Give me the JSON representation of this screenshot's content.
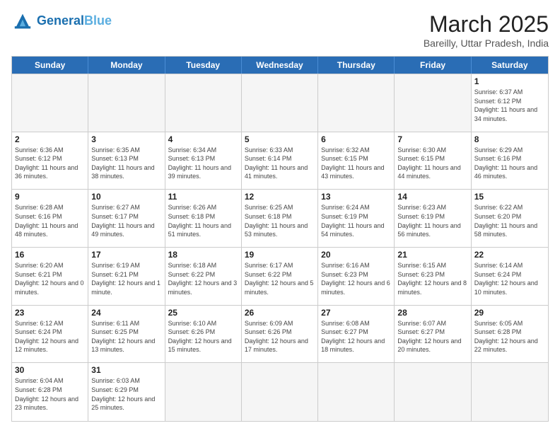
{
  "header": {
    "logo_general": "General",
    "logo_blue": "Blue",
    "month_title": "March 2025",
    "subtitle": "Bareilly, Uttar Pradesh, India"
  },
  "day_headers": [
    "Sunday",
    "Monday",
    "Tuesday",
    "Wednesday",
    "Thursday",
    "Friday",
    "Saturday"
  ],
  "days": [
    {
      "num": "",
      "sunrise": "",
      "sunset": "",
      "daylight": "",
      "empty": true
    },
    {
      "num": "",
      "sunrise": "",
      "sunset": "",
      "daylight": "",
      "empty": true
    },
    {
      "num": "",
      "sunrise": "",
      "sunset": "",
      "daylight": "",
      "empty": true
    },
    {
      "num": "",
      "sunrise": "",
      "sunset": "",
      "daylight": "",
      "empty": true
    },
    {
      "num": "",
      "sunrise": "",
      "sunset": "",
      "daylight": "",
      "empty": true
    },
    {
      "num": "",
      "sunrise": "",
      "sunset": "",
      "daylight": "",
      "empty": true
    },
    {
      "num": "1",
      "sunrise": "Sunrise: 6:37 AM",
      "sunset": "Sunset: 6:12 PM",
      "daylight": "Daylight: 11 hours and 34 minutes.",
      "empty": false
    },
    {
      "num": "2",
      "sunrise": "Sunrise: 6:36 AM",
      "sunset": "Sunset: 6:12 PM",
      "daylight": "Daylight: 11 hours and 36 minutes.",
      "empty": false
    },
    {
      "num": "3",
      "sunrise": "Sunrise: 6:35 AM",
      "sunset": "Sunset: 6:13 PM",
      "daylight": "Daylight: 11 hours and 38 minutes.",
      "empty": false
    },
    {
      "num": "4",
      "sunrise": "Sunrise: 6:34 AM",
      "sunset": "Sunset: 6:13 PM",
      "daylight": "Daylight: 11 hours and 39 minutes.",
      "empty": false
    },
    {
      "num": "5",
      "sunrise": "Sunrise: 6:33 AM",
      "sunset": "Sunset: 6:14 PM",
      "daylight": "Daylight: 11 hours and 41 minutes.",
      "empty": false
    },
    {
      "num": "6",
      "sunrise": "Sunrise: 6:32 AM",
      "sunset": "Sunset: 6:15 PM",
      "daylight": "Daylight: 11 hours and 43 minutes.",
      "empty": false
    },
    {
      "num": "7",
      "sunrise": "Sunrise: 6:30 AM",
      "sunset": "Sunset: 6:15 PM",
      "daylight": "Daylight: 11 hours and 44 minutes.",
      "empty": false
    },
    {
      "num": "8",
      "sunrise": "Sunrise: 6:29 AM",
      "sunset": "Sunset: 6:16 PM",
      "daylight": "Daylight: 11 hours and 46 minutes.",
      "empty": false
    },
    {
      "num": "9",
      "sunrise": "Sunrise: 6:28 AM",
      "sunset": "Sunset: 6:16 PM",
      "daylight": "Daylight: 11 hours and 48 minutes.",
      "empty": false
    },
    {
      "num": "10",
      "sunrise": "Sunrise: 6:27 AM",
      "sunset": "Sunset: 6:17 PM",
      "daylight": "Daylight: 11 hours and 49 minutes.",
      "empty": false
    },
    {
      "num": "11",
      "sunrise": "Sunrise: 6:26 AM",
      "sunset": "Sunset: 6:18 PM",
      "daylight": "Daylight: 11 hours and 51 minutes.",
      "empty": false
    },
    {
      "num": "12",
      "sunrise": "Sunrise: 6:25 AM",
      "sunset": "Sunset: 6:18 PM",
      "daylight": "Daylight: 11 hours and 53 minutes.",
      "empty": false
    },
    {
      "num": "13",
      "sunrise": "Sunrise: 6:24 AM",
      "sunset": "Sunset: 6:19 PM",
      "daylight": "Daylight: 11 hours and 54 minutes.",
      "empty": false
    },
    {
      "num": "14",
      "sunrise": "Sunrise: 6:23 AM",
      "sunset": "Sunset: 6:19 PM",
      "daylight": "Daylight: 11 hours and 56 minutes.",
      "empty": false
    },
    {
      "num": "15",
      "sunrise": "Sunrise: 6:22 AM",
      "sunset": "Sunset: 6:20 PM",
      "daylight": "Daylight: 11 hours and 58 minutes.",
      "empty": false
    },
    {
      "num": "16",
      "sunrise": "Sunrise: 6:20 AM",
      "sunset": "Sunset: 6:21 PM",
      "daylight": "Daylight: 12 hours and 0 minutes.",
      "empty": false
    },
    {
      "num": "17",
      "sunrise": "Sunrise: 6:19 AM",
      "sunset": "Sunset: 6:21 PM",
      "daylight": "Daylight: 12 hours and 1 minute.",
      "empty": false
    },
    {
      "num": "18",
      "sunrise": "Sunrise: 6:18 AM",
      "sunset": "Sunset: 6:22 PM",
      "daylight": "Daylight: 12 hours and 3 minutes.",
      "empty": false
    },
    {
      "num": "19",
      "sunrise": "Sunrise: 6:17 AM",
      "sunset": "Sunset: 6:22 PM",
      "daylight": "Daylight: 12 hours and 5 minutes.",
      "empty": false
    },
    {
      "num": "20",
      "sunrise": "Sunrise: 6:16 AM",
      "sunset": "Sunset: 6:23 PM",
      "daylight": "Daylight: 12 hours and 6 minutes.",
      "empty": false
    },
    {
      "num": "21",
      "sunrise": "Sunrise: 6:15 AM",
      "sunset": "Sunset: 6:23 PM",
      "daylight": "Daylight: 12 hours and 8 minutes.",
      "empty": false
    },
    {
      "num": "22",
      "sunrise": "Sunrise: 6:14 AM",
      "sunset": "Sunset: 6:24 PM",
      "daylight": "Daylight: 12 hours and 10 minutes.",
      "empty": false
    },
    {
      "num": "23",
      "sunrise": "Sunrise: 6:12 AM",
      "sunset": "Sunset: 6:24 PM",
      "daylight": "Daylight: 12 hours and 12 minutes.",
      "empty": false
    },
    {
      "num": "24",
      "sunrise": "Sunrise: 6:11 AM",
      "sunset": "Sunset: 6:25 PM",
      "daylight": "Daylight: 12 hours and 13 minutes.",
      "empty": false
    },
    {
      "num": "25",
      "sunrise": "Sunrise: 6:10 AM",
      "sunset": "Sunset: 6:26 PM",
      "daylight": "Daylight: 12 hours and 15 minutes.",
      "empty": false
    },
    {
      "num": "26",
      "sunrise": "Sunrise: 6:09 AM",
      "sunset": "Sunset: 6:26 PM",
      "daylight": "Daylight: 12 hours and 17 minutes.",
      "empty": false
    },
    {
      "num": "27",
      "sunrise": "Sunrise: 6:08 AM",
      "sunset": "Sunset: 6:27 PM",
      "daylight": "Daylight: 12 hours and 18 minutes.",
      "empty": false
    },
    {
      "num": "28",
      "sunrise": "Sunrise: 6:07 AM",
      "sunset": "Sunset: 6:27 PM",
      "daylight": "Daylight: 12 hours and 20 minutes.",
      "empty": false
    },
    {
      "num": "29",
      "sunrise": "Sunrise: 6:05 AM",
      "sunset": "Sunset: 6:28 PM",
      "daylight": "Daylight: 12 hours and 22 minutes.",
      "empty": false
    },
    {
      "num": "30",
      "sunrise": "Sunrise: 6:04 AM",
      "sunset": "Sunset: 6:28 PM",
      "daylight": "Daylight: 12 hours and 23 minutes.",
      "empty": false
    },
    {
      "num": "31",
      "sunrise": "Sunrise: 6:03 AM",
      "sunset": "Sunset: 6:29 PM",
      "daylight": "Daylight: 12 hours and 25 minutes.",
      "empty": false
    },
    {
      "num": "",
      "sunrise": "",
      "sunset": "",
      "daylight": "",
      "empty": true
    },
    {
      "num": "",
      "sunrise": "",
      "sunset": "",
      "daylight": "",
      "empty": true
    },
    {
      "num": "",
      "sunrise": "",
      "sunset": "",
      "daylight": "",
      "empty": true
    },
    {
      "num": "",
      "sunrise": "",
      "sunset": "",
      "daylight": "",
      "empty": true
    },
    {
      "num": "",
      "sunrise": "",
      "sunset": "",
      "daylight": "",
      "empty": true
    }
  ]
}
